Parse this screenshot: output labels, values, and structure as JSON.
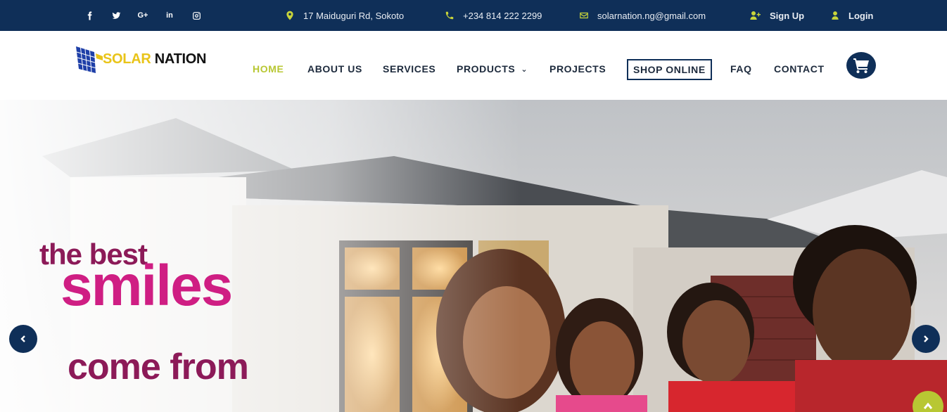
{
  "topbar": {
    "social": [
      {
        "name": "facebook-icon",
        "glyph": "f"
      },
      {
        "name": "twitter-icon",
        "glyph": ""
      },
      {
        "name": "google-plus-icon",
        "glyph": "G+"
      },
      {
        "name": "linkedin-icon",
        "glyph": "in"
      },
      {
        "name": "instagram-icon",
        "glyph": ""
      }
    ],
    "address": "17 Maiduguri Rd, Sokoto",
    "phone": "+234 814 222 2299",
    "email": "solarnation.ng@gmail.com",
    "signup_label": "Sign Up",
    "login_label": "Login"
  },
  "brand": {
    "part1": "SOLAR",
    "part2": " NATION"
  },
  "nav": {
    "home": "HOME",
    "about": "ABOUT US",
    "services": "SERVICES",
    "products": "PRODUCTS",
    "projects": "PROJECTS",
    "shop": "SHOP ONLINE",
    "faq": "FAQ",
    "contact": "CONTACT"
  },
  "hero": {
    "line1": "the best",
    "line2": "smiles",
    "line3": "come from"
  },
  "colors": {
    "navy": "#0f2f58",
    "accent": "#b8c733",
    "magenta": "#cf1e83",
    "plum": "#8c1a58"
  }
}
